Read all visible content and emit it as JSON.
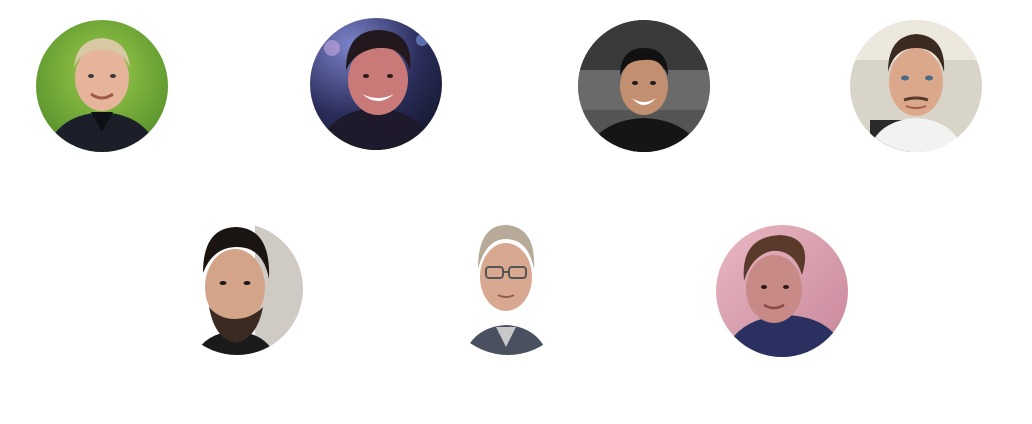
{
  "team": {
    "avatars": [
      {
        "icon": "person-avatar-icon"
      },
      {
        "icon": "person-avatar-icon"
      },
      {
        "icon": "person-avatar-icon"
      },
      {
        "icon": "person-avatar-icon"
      },
      {
        "icon": "person-avatar-icon"
      },
      {
        "icon": "person-avatar-icon"
      },
      {
        "icon": "person-avatar-icon"
      }
    ]
  }
}
